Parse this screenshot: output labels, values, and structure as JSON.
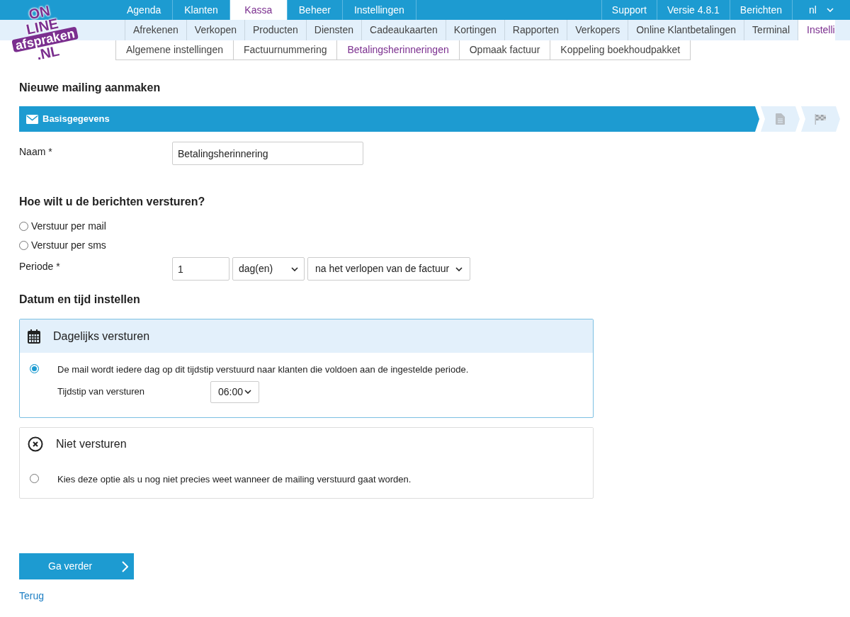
{
  "logo": {
    "lines": [
      "ON",
      "LINE",
      "afspraken",
      ".NL"
    ]
  },
  "main_nav": {
    "left": [
      {
        "label": "Agenda",
        "selected": false
      },
      {
        "label": "Klanten",
        "selected": false
      },
      {
        "label": "Kassa",
        "selected": true
      },
      {
        "label": "Beheer",
        "selected": false
      },
      {
        "label": "Instellingen",
        "selected": false
      }
    ],
    "right": [
      {
        "label": "Support"
      },
      {
        "label": "Versie 4.8.1"
      },
      {
        "label": "Berichten"
      },
      {
        "label": "nl",
        "kind": "dropdown"
      }
    ]
  },
  "sub_nav": [
    {
      "label": "Afrekenen",
      "selected": false
    },
    {
      "label": "Verkopen",
      "selected": false
    },
    {
      "label": "Producten",
      "selected": false
    },
    {
      "label": "Diensten",
      "selected": false
    },
    {
      "label": "Cadeaukaarten",
      "selected": false
    },
    {
      "label": "Kortingen",
      "selected": false
    },
    {
      "label": "Rapporten",
      "selected": false
    },
    {
      "label": "Verkopers",
      "selected": false
    },
    {
      "label": "Online Klantbetalingen",
      "selected": false
    },
    {
      "label": "Terminal",
      "selected": false
    },
    {
      "label": "Instelli",
      "selected": true
    }
  ],
  "settings_tabs": [
    {
      "label": "Algemene instellingen",
      "selected": false
    },
    {
      "label": "Factuurnummering",
      "selected": false
    },
    {
      "label": "Betalingsherinneringen",
      "selected": true
    },
    {
      "label": "Opmaak factuur",
      "selected": false
    },
    {
      "label": "Koppeling boekhoudpakket",
      "selected": false
    }
  ],
  "page_title": "Nieuwe mailing aanmaken",
  "steps": [
    {
      "kind": "mail",
      "label": "Basisgegevens",
      "selected": true
    },
    {
      "kind": "document",
      "selected": false
    },
    {
      "kind": "flag",
      "selected": false
    }
  ],
  "name_field": {
    "label": "Naam *",
    "value": "Betalingsherinnering"
  },
  "send_section": {
    "title": "Hoe wilt u de berichten versturen?",
    "options": [
      {
        "label": "Verstuur per mail",
        "selected": false
      },
      {
        "label": "Verstuur per sms",
        "selected": false
      }
    ]
  },
  "period": {
    "label": "Periode *",
    "value": "1",
    "unit": "dag(en)",
    "relation": "na het verlopen van de factuur"
  },
  "schedule": {
    "title": "Datum en tijd instellen",
    "options": [
      {
        "kind": "calendar",
        "title": "Dagelijks versturen",
        "selected": true,
        "description": "De mail wordt iedere dag op dit tijdstip verstuurd naar klanten die voldoen aan de ingestelde periode.",
        "time_label": "Tijdstip van versturen",
        "time": "06:00"
      },
      {
        "kind": "cancel",
        "title": "Niet versturen",
        "selected": false,
        "description": "Kies deze optie als u nog niet precies weet wanneer de mailing verstuurd gaat worden."
      }
    ]
  },
  "continue_button": "Ga verder",
  "back_link": "Terug"
}
